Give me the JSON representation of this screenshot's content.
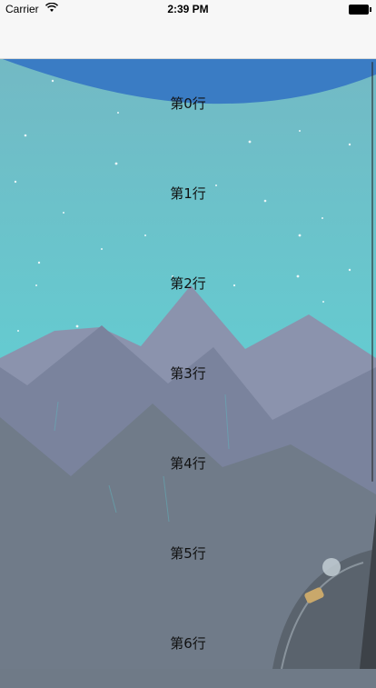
{
  "status_bar": {
    "carrier": "Carrier",
    "time": "2:39 PM",
    "wifi_icon": "wifi-icon",
    "battery_icon": "battery-icon"
  },
  "nav_bar": {
    "title": ""
  },
  "table": {
    "rows": [
      {
        "label": "第0行"
      },
      {
        "label": "第1行"
      },
      {
        "label": "第2行"
      },
      {
        "label": "第3行"
      },
      {
        "label": "第4行"
      },
      {
        "label": "第5行"
      },
      {
        "label": "第6行"
      }
    ]
  },
  "background": {
    "image": "mountain-night-illustration",
    "colors": {
      "sky_top": "#3a7cc4",
      "sky": "#6fc6cc",
      "sky_low": "#5ccfd7",
      "mountain_far": "#8a93ad",
      "mountain_mid": "#7b849e",
      "mountain_front": "#6f7a87"
    }
  }
}
